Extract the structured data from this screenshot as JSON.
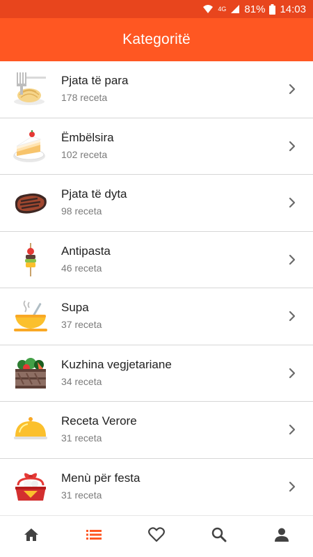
{
  "status_bar": {
    "battery": "81%",
    "time": "14:03",
    "network": "4G",
    "icons": [
      "wifi-icon",
      "signal-icon",
      "battery-icon"
    ]
  },
  "header": {
    "title": "Kategoritë"
  },
  "categories": [
    {
      "name": "Pjata të para",
      "count": "178 receta",
      "icon": "spaghetti-icon"
    },
    {
      "name": "Ëmbëlsira",
      "count": "102 receta",
      "icon": "cake-slice-icon"
    },
    {
      "name": "Pjata të dyta",
      "count": "98 receta",
      "icon": "steak-icon"
    },
    {
      "name": "Antipasta",
      "count": "46 receta",
      "icon": "skewer-icon"
    },
    {
      "name": "Supa",
      "count": "37 receta",
      "icon": "soup-bowl-icon"
    },
    {
      "name": "Kuzhina vegjetariane",
      "count": "34 receta",
      "icon": "vegetable-crate-icon"
    },
    {
      "name": "Receta Verore",
      "count": "31 receta",
      "icon": "cloche-icon"
    },
    {
      "name": "Menù për festa",
      "count": "31 receta",
      "icon": "gift-basket-icon"
    }
  ],
  "bottom_nav": {
    "active": "categories",
    "tabs": [
      "home-icon",
      "list-icon",
      "heart-icon",
      "search-icon",
      "profile-icon"
    ]
  },
  "colors": {
    "accent": "#ff5722",
    "status_bar": "#e8451d",
    "divider": "#d6d6d6",
    "icon_inactive": "#424242"
  }
}
